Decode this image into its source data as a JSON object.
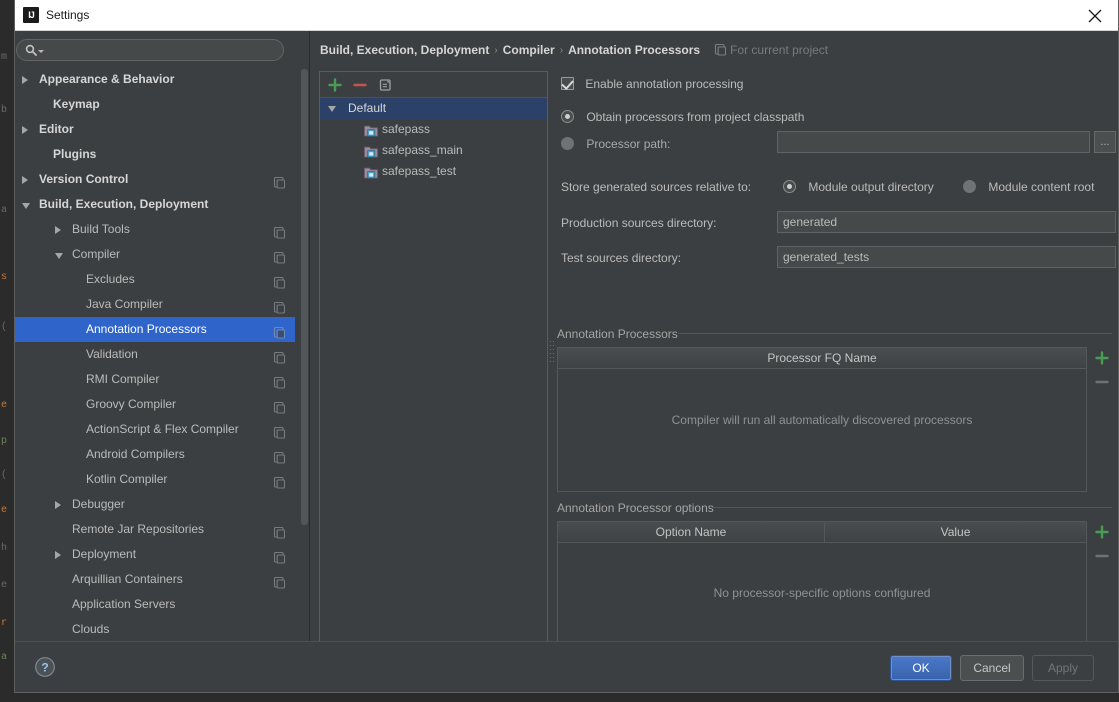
{
  "window": {
    "title": "Settings",
    "app_icon": "intellij-idea-icon",
    "close_icon": "close-icon"
  },
  "search": {
    "value": "",
    "placeholder": "",
    "icon": "search-icon"
  },
  "sidebar": {
    "items": [
      {
        "label": "Appearance & Behavior",
        "indent": 24,
        "arrow": "closed",
        "bold": true,
        "selected": false,
        "badge": false
      },
      {
        "label": "Keymap",
        "indent": 38,
        "arrow": "none",
        "bold": true,
        "selected": false,
        "badge": false
      },
      {
        "label": "Editor",
        "indent": 24,
        "arrow": "closed",
        "bold": true,
        "selected": false,
        "badge": false
      },
      {
        "label": "Plugins",
        "indent": 38,
        "arrow": "none",
        "bold": true,
        "selected": false,
        "badge": false
      },
      {
        "label": "Version Control",
        "indent": 24,
        "arrow": "closed",
        "bold": true,
        "selected": false,
        "badge": true
      },
      {
        "label": "Build, Execution, Deployment",
        "indent": 24,
        "arrow": "open",
        "bold": true,
        "selected": false,
        "badge": false
      },
      {
        "label": "Build Tools",
        "indent": 57,
        "arrow": "closed",
        "bold": false,
        "selected": false,
        "badge": true
      },
      {
        "label": "Compiler",
        "indent": 57,
        "arrow": "open",
        "bold": false,
        "selected": false,
        "badge": true
      },
      {
        "label": "Excludes",
        "indent": 71,
        "arrow": "none",
        "bold": false,
        "selected": false,
        "badge": true
      },
      {
        "label": "Java Compiler",
        "indent": 71,
        "arrow": "none",
        "bold": false,
        "selected": false,
        "badge": true
      },
      {
        "label": "Annotation Processors",
        "indent": 71,
        "arrow": "none",
        "bold": false,
        "selected": true,
        "badge": true
      },
      {
        "label": "Validation",
        "indent": 71,
        "arrow": "none",
        "bold": false,
        "selected": false,
        "badge": true
      },
      {
        "label": "RMI Compiler",
        "indent": 71,
        "arrow": "none",
        "bold": false,
        "selected": false,
        "badge": true
      },
      {
        "label": "Groovy Compiler",
        "indent": 71,
        "arrow": "none",
        "bold": false,
        "selected": false,
        "badge": true
      },
      {
        "label": "ActionScript & Flex Compiler",
        "indent": 71,
        "arrow": "none",
        "bold": false,
        "selected": false,
        "badge": true
      },
      {
        "label": "Android Compilers",
        "indent": 71,
        "arrow": "none",
        "bold": false,
        "selected": false,
        "badge": true
      },
      {
        "label": "Kotlin Compiler",
        "indent": 71,
        "arrow": "none",
        "bold": false,
        "selected": false,
        "badge": true
      },
      {
        "label": "Debugger",
        "indent": 57,
        "arrow": "closed",
        "bold": false,
        "selected": false,
        "badge": false
      },
      {
        "label": "Remote Jar Repositories",
        "indent": 57,
        "arrow": "none",
        "bold": false,
        "selected": false,
        "badge": true
      },
      {
        "label": "Deployment",
        "indent": 57,
        "arrow": "closed",
        "bold": false,
        "selected": false,
        "badge": true
      },
      {
        "label": "Arquillian Containers",
        "indent": 57,
        "arrow": "none",
        "bold": false,
        "selected": false,
        "badge": true
      },
      {
        "label": "Application Servers",
        "indent": 57,
        "arrow": "none",
        "bold": false,
        "selected": false,
        "badge": false
      },
      {
        "label": "Clouds",
        "indent": 57,
        "arrow": "none",
        "bold": false,
        "selected": false,
        "badge": false
      }
    ]
  },
  "breadcrumb": {
    "crumbs": [
      "Build, Execution, Deployment",
      "Compiler",
      "Annotation Processors"
    ],
    "separator": "›",
    "scope_icon": "project-scope-icon",
    "scope_text": "For current project"
  },
  "modules": {
    "toolbar": {
      "add_icon": "plus-icon",
      "remove_icon": "minus-icon",
      "copy_icon": "copy-profile-icon"
    },
    "rows": [
      {
        "label": "Default",
        "type": "profile",
        "selected": true,
        "indent": 28
      },
      {
        "label": "safepass",
        "type": "module",
        "selected": false,
        "indent": 62
      },
      {
        "label": "safepass_main",
        "type": "module",
        "selected": false,
        "indent": 62
      },
      {
        "label": "safepass_test",
        "type": "module",
        "selected": false,
        "indent": 62
      }
    ]
  },
  "form": {
    "enable_annotation_processing": {
      "label": "Enable annotation processing",
      "checked": true
    },
    "source_mode": {
      "obtain_from_classpath": {
        "label": "Obtain processors from project classpath",
        "selected": true
      },
      "processor_path": {
        "label": "Processor path:",
        "selected": false,
        "value": "",
        "browse_label": "..."
      }
    },
    "store_relative": {
      "label": "Store generated sources relative to:",
      "options": [
        {
          "label": "Module output directory",
          "selected": true
        },
        {
          "label": "Module content root",
          "selected": false
        }
      ]
    },
    "production_sources": {
      "label": "Production sources directory:",
      "value": "generated"
    },
    "test_sources": {
      "label": "Test sources directory:",
      "value": "generated_tests"
    }
  },
  "processors_table": {
    "title": "Annotation Processors",
    "columns": [
      "Processor FQ Name"
    ],
    "rows": [],
    "empty_text": "Compiler will run all automatically discovered processors",
    "add_icon": "plus-icon",
    "remove_icon": "minus-icon"
  },
  "options_table": {
    "title": "Annotation Processor options",
    "columns": [
      "Option Name",
      "Value"
    ],
    "rows": [],
    "empty_text": "No processor-specific options configured",
    "add_icon": "plus-icon",
    "remove_icon": "minus-icon"
  },
  "footer": {
    "help_icon": "help-icon",
    "ok_label": "OK",
    "cancel_label": "Cancel",
    "apply_label": "Apply",
    "apply_enabled": false
  },
  "colors": {
    "dialog_bg": "#3c3f41",
    "selection_blue": "#2f65ca",
    "module_selection": "#2b4168",
    "accent_green": "#499c54",
    "accent_red": "#c75450",
    "primary_button": "#4b79c9",
    "text": "#bbbbbb"
  }
}
